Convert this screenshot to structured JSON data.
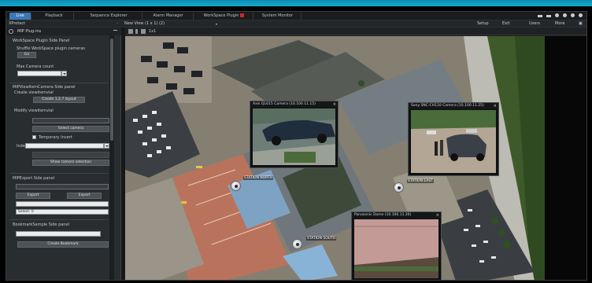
{
  "menu": {
    "tabs": [
      {
        "label": "Live"
      },
      {
        "label": "Playback"
      },
      {
        "label": "Sequence Explorer"
      },
      {
        "label": "Alarm Manager"
      },
      {
        "label": "WorkSpace Plugin"
      },
      {
        "label": "System Monitor"
      }
    ]
  },
  "titlebar": {
    "app_title": "XProtect",
    "view_selector": "New View (1 x 1) (2)",
    "setup": "Setup",
    "exit": "Exit",
    "user": "Users",
    "more": "More"
  },
  "sidebar": {
    "header": "MIP Plug-ins",
    "sec1_title": "WorkSpace Plugin Side Panel",
    "shuffle_label": "Shuffle WorkSpace plugin cameras",
    "go_button": "Go",
    "max_camera_label": "Max Camera count",
    "sec2_title": "MIPViewItemCamera Side panel",
    "create_label": "Create viewitemvial",
    "create_button": "Create 1,2,7 layout",
    "modify_label": "Modify viewitemvial",
    "select_camera_button": "Select camera",
    "temporary_label": "Temporary Invert",
    "index_label": "Index",
    "show_button": "Show camera selection",
    "sec3_title": "MIPExport Side panel",
    "export_btn_left": "Export",
    "export_btn_right": "Export",
    "export_field": "Select: 0",
    "sec4_title": "BookmarkSample Side panel",
    "bookmark_button": "Create Bookmark"
  },
  "toolstrip": {
    "layout_label": "1x1"
  },
  "map": {
    "camera_labels": [
      "STATION NORTH",
      "STATION EAST",
      "STATION SOUTH"
    ]
  },
  "cameras": [
    {
      "title": "Axis Q1615 Camera (10.100.11.15)",
      "theme": "car-road"
    },
    {
      "title": "Sony SNC-CH110 Camera (10.100.11.25)",
      "theme": "parking"
    },
    {
      "title": "Panasonic Dome (10.100.11.26)",
      "theme": "wall"
    }
  ]
}
